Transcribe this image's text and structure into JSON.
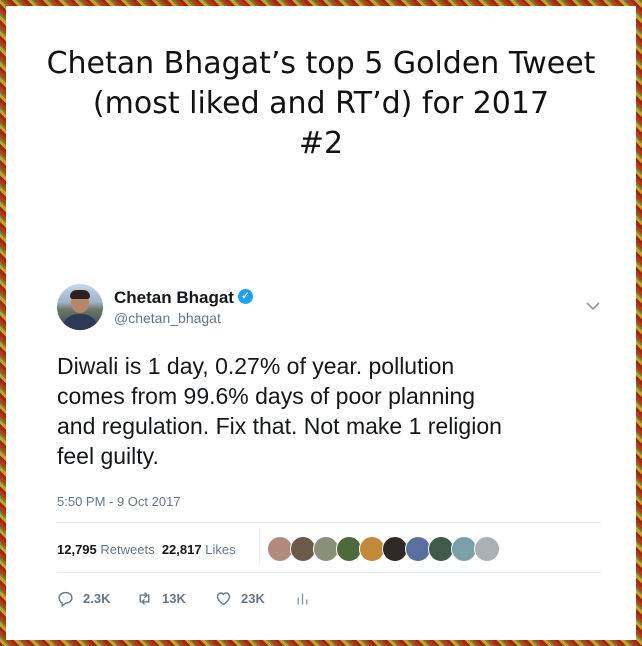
{
  "headline": {
    "line1": "Chetan Bhagat’s top 5 Golden Tweet",
    "line2": "(most liked and RT’d) for 2017",
    "line3": "#2"
  },
  "tweet": {
    "author_name": "Chetan Bhagat",
    "handle": "@chetan_bhagat",
    "verified": true,
    "text_lines": [
      "Diwali is 1 day, 0.27% of year. pollution",
      "comes from 99.6% days of poor planning",
      "and regulation. Fix that. Not make 1 religion",
      "feel guilty."
    ],
    "timestamp": "5:50 PM - 9 Oct 2017",
    "retweets_count": "12,795",
    "retweets_label": "Retweets",
    "likes_count": "22,817",
    "likes_label": "Likes",
    "liker_colors": [
      "#b08a7a",
      "#6b5a4a",
      "#8a8f7a",
      "#4f6a3a",
      "#c08a3a",
      "#2f2a26",
      "#5a6fa0",
      "#3f5a4a",
      "#7aa0a8",
      "#aab0b6"
    ],
    "actions": {
      "replies": "2.3K",
      "retweets": "13K",
      "likes": "23K"
    }
  },
  "icons": {
    "verified": "verified-badge-icon",
    "chevron": "chevron-down-icon",
    "reply": "reply-icon",
    "retweet": "retweet-icon",
    "like": "heart-icon",
    "analytics": "analytics-icon"
  },
  "colors": {
    "accent": "#1da1f2",
    "secondary_text": "#657786",
    "border_red": "#9a2a12",
    "border_gold": "#c7a12f"
  }
}
